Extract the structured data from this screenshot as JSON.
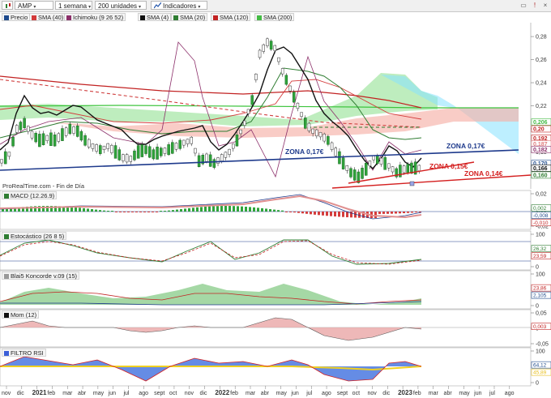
{
  "toolbar": {
    "symbol": "AMP",
    "period": "1 semana",
    "units": "200 unidades",
    "indicators": "Indicadores"
  },
  "price_legend": [
    {
      "label": "Precio",
      "color": "#1e4a8c"
    },
    {
      "label": "SMA (40)",
      "color": "#d33a3a"
    },
    {
      "label": "Ichimoku (9 26 52)",
      "color": "#8c2f6a"
    },
    {
      "label": "SMA (4)",
      "color": "#111111"
    },
    {
      "label": "SMA (20)",
      "color": "#2f7d32"
    },
    {
      "label": "SMA (120)",
      "color": "#c22222"
    },
    {
      "label": "SMA (200)",
      "color": "#44bb44"
    }
  ],
  "footer_source": "ProRealTime.com - Fin de Día",
  "annotations": {
    "zona_017_left": "ZONA 0,17€",
    "zona_017_right": "ZONA 0,17€",
    "zona_015": "ZONA 0,15€",
    "zona_014": "ZONA 0,14€"
  },
  "chart_data": [
    {
      "type": "line",
      "title": "AMP",
      "y_ticks": [
        "0,28",
        "0,26",
        "0,24",
        "0,22",
        "0,20",
        "0,18",
        "0,16"
      ],
      "y_badges": [
        {
          "text": "0,206",
          "color": "#44bb44"
        },
        {
          "text": "0,20",
          "color": "#c22222"
        },
        {
          "text": "0,192",
          "color": "#c22222"
        },
        {
          "text": "0,187",
          "color": "#e08080"
        },
        {
          "text": "0,182",
          "color": "#8c2f6a"
        },
        {
          "text": "0,170",
          "color": "#1e4a8c"
        },
        {
          "text": "0,166",
          "color": "#111111"
        },
        {
          "text": "0,160",
          "color": "#2f7d32"
        }
      ],
      "ylim": [
        0.148,
        0.292
      ],
      "x": [
        0,
        2,
        4,
        6,
        8,
        10,
        12,
        14,
        16,
        18,
        20,
        22,
        24,
        26,
        28,
        30,
        32,
        34,
        36,
        38,
        40,
        42,
        44,
        46,
        48,
        50,
        52,
        54,
        56,
        58,
        60,
        62,
        64,
        66,
        68,
        70,
        72,
        74,
        76,
        78,
        80,
        82,
        84,
        86,
        88,
        90,
        92,
        94,
        96,
        98,
        100,
        102,
        104,
        106,
        108,
        110
      ],
      "series": [
        {
          "name": "SMA (4)",
          "values": [
            0.172,
            0.178,
            0.2,
            0.205,
            0.195,
            0.19,
            0.192,
            0.19,
            0.195,
            0.2,
            0.198,
            0.19,
            0.185,
            0.182,
            0.185,
            0.18,
            0.175,
            0.174,
            0.18,
            0.182,
            0.178,
            0.18,
            0.182,
            0.185,
            0.188,
            0.19,
            0.172,
            0.175,
            0.17,
            0.175,
            0.18,
            0.19,
            0.205,
            0.225,
            0.265,
            0.275,
            0.27,
            0.25,
            0.235,
            0.22,
            0.205,
            0.198,
            0.195,
            0.19,
            0.18,
            0.17,
            0.162,
            0.158,
            0.165,
            0.175,
            0.172,
            0.168,
            0.162,
            0.165,
            0.166,
            0.166
          ]
        }
      ]
    },
    {
      "type": "bar",
      "title": "MACD (12.26.9)",
      "y_ticks": [
        "0,02",
        "0,00",
        "-0,02"
      ],
      "y_badges": [
        {
          "text": "0,002",
          "color": "#2f7d32"
        },
        {
          "text": "-0,008",
          "color": "#1e4a8c"
        },
        {
          "text": "-0,010",
          "color": "#c22222"
        }
      ]
    },
    {
      "type": "line",
      "title": "Estocástico (26 8 5)",
      "y_ticks": [
        "100",
        "0"
      ],
      "y_badges": [
        {
          "text": "26,32",
          "color": "#2f7d32"
        },
        {
          "text": "23,59",
          "color": "#c22222"
        }
      ]
    },
    {
      "type": "area",
      "title": "Blai5 Koncorde v.09 (15)",
      "y_ticks": [
        "100",
        "0"
      ],
      "y_badges": [
        {
          "text": "23,86",
          "color": "#c22222"
        },
        {
          "text": "2,105",
          "color": "#1e4a8c"
        }
      ]
    },
    {
      "type": "area",
      "title": "Mom (12)",
      "y_ticks": [
        "0,05",
        "0",
        "-0,05"
      ],
      "y_badges": [
        {
          "text": "0,003",
          "color": "#c22222"
        }
      ]
    },
    {
      "type": "area",
      "title": "FILTRO RSI",
      "y_ticks": [
        "100",
        "0"
      ],
      "y_badges": [
        {
          "text": "64,12",
          "color": "#1e4a8c"
        },
        {
          "text": "45,89",
          "color": "#e8c020"
        }
      ]
    }
  ],
  "x_axis": {
    "labels": [
      "nov",
      "dic",
      "2021",
      "feb",
      "mar",
      "abr",
      "may",
      "jun",
      "jul",
      "ago",
      "sept",
      "oct",
      "nov",
      "dic",
      "2022",
      "feb",
      "mar",
      "abr",
      "may",
      "jun",
      "jul",
      "ago",
      "sept",
      "oct",
      "nov",
      "dic",
      "2023",
      "feb",
      "mar",
      "abr",
      "may",
      "jun",
      "jul",
      "ago"
    ],
    "bold": [
      "2021",
      "2022",
      "2023"
    ]
  }
}
